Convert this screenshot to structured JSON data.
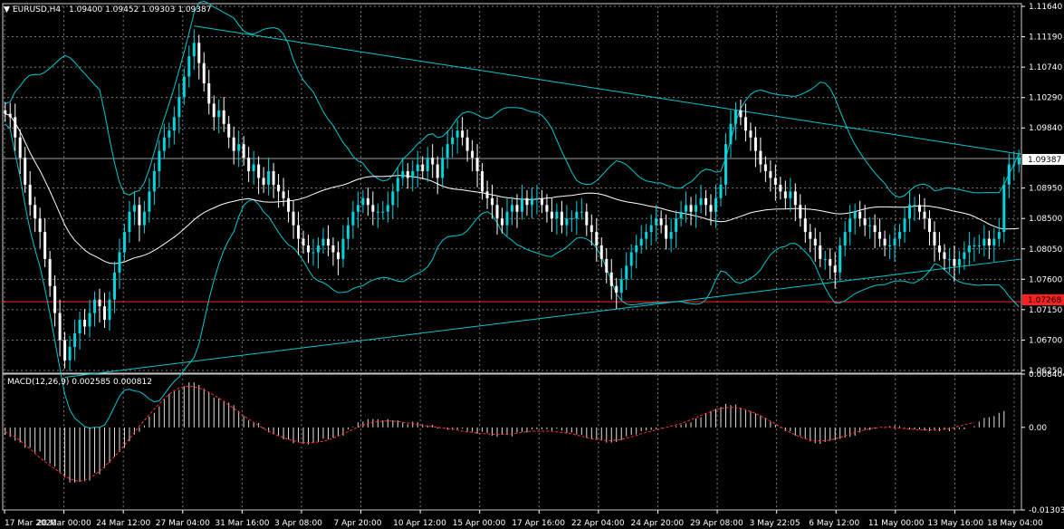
{
  "chart_data": [
    {
      "type": "candlestick",
      "header": {
        "symbol_tf": "EURUSD,H4",
        "values": "1.09400 1.09452 1.09303 1.09387"
      },
      "colors": {
        "background": "#000000",
        "bull": "#00d4dc",
        "bear": "#ffffff",
        "band": "#00c8d0",
        "ma": "#ffffff",
        "trend": "#00c8d0",
        "level": "#ff2020",
        "grid": "#7a7a7a",
        "text": "#ffffff"
      },
      "ylim": [
        1.0625,
        1.1164
      ],
      "yticks": [
        "1.11640",
        "1.11190",
        "1.10740",
        "1.10290",
        "1.09840",
        "1.09387",
        "1.08950",
        "1.08500",
        "1.08050",
        "1.07600",
        "1.07150",
        "1.06700",
        "1.06250"
      ],
      "current_price": {
        "label": "1.09387",
        "value": 1.09387
      },
      "level_line": {
        "label": "1.07268",
        "value": 1.07268
      },
      "xlabels": [
        "17 Mar 2020",
        "20 Mar 00:00",
        "24 Mar 12:00",
        "27 Mar 04:00",
        "31 Mar 16:00",
        "3 Apr 08:00",
        "7 Apr 20:00",
        "10 Apr 12:00",
        "15 Apr 00:00",
        "17 Apr 16:00",
        "22 Apr 04:00",
        "24 Apr 20:00",
        "29 Apr 08:00",
        "3 May 22:05",
        "6 May 12:00",
        "11 May 00:00",
        "13 May 16:00",
        "18 May 04:00"
      ],
      "close": [
        1.1005,
        1.1,
        1.097,
        1.094,
        1.09,
        1.087,
        1.085,
        1.083,
        1.079,
        1.075,
        1.071,
        1.067,
        1.064,
        1.066,
        1.068,
        1.07,
        1.069,
        1.071,
        1.073,
        1.072,
        1.07,
        1.073,
        1.077,
        1.08,
        1.083,
        1.086,
        1.087,
        1.084,
        1.086,
        1.089,
        1.092,
        1.095,
        1.097,
        1.098,
        1.1,
        1.103,
        1.106,
        1.109,
        1.111,
        1.108,
        1.105,
        1.102,
        1.1,
        1.101,
        1.099,
        1.097,
        1.095,
        1.096,
        1.094,
        1.092,
        1.093,
        1.091,
        1.09,
        1.092,
        1.09,
        1.089,
        1.088,
        1.086,
        1.084,
        1.082,
        1.081,
        1.08,
        1.08,
        1.081,
        1.082,
        1.081,
        1.08,
        1.079,
        1.082,
        1.084,
        1.086,
        1.087,
        1.088,
        1.087,
        1.086,
        1.086,
        1.086,
        1.087,
        1.089,
        1.091,
        1.092,
        1.091,
        1.092,
        1.093,
        1.092,
        1.094,
        1.093,
        1.091,
        1.094,
        1.096,
        1.097,
        1.098,
        1.097,
        1.095,
        1.094,
        1.092,
        1.089,
        1.088,
        1.087,
        1.085,
        1.084,
        1.086,
        1.087,
        1.086,
        1.088,
        1.087,
        1.088,
        1.088,
        1.087,
        1.086,
        1.085,
        1.086,
        1.084,
        1.085,
        1.085,
        1.086,
        1.086,
        1.084,
        1.083,
        1.081,
        1.079,
        1.077,
        1.075,
        1.074,
        1.076,
        1.078,
        1.08,
        1.081,
        1.082,
        1.083,
        1.084,
        1.085,
        1.084,
        1.082,
        1.083,
        1.085,
        1.086,
        1.087,
        1.086,
        1.087,
        1.088,
        1.087,
        1.086,
        1.088,
        1.09,
        1.096,
        1.099,
        1.101,
        1.1,
        1.098,
        1.097,
        1.095,
        1.093,
        1.092,
        1.091,
        1.09,
        1.089,
        1.088,
        1.089,
        1.087,
        1.085,
        1.083,
        1.082,
        1.081,
        1.079,
        1.079,
        1.078,
        1.077,
        1.081,
        1.083,
        1.085,
        1.086,
        1.085,
        1.084,
        1.084,
        1.083,
        1.082,
        1.081,
        1.081,
        1.082,
        1.083,
        1.085,
        1.087,
        1.087,
        1.086,
        1.085,
        1.083,
        1.081,
        1.08,
        1.079,
        1.079,
        1.078,
        1.079,
        1.08,
        1.081,
        1.081,
        1.081,
        1.082,
        1.081,
        1.082,
        1.083,
        1.09,
        1.093,
        1.093,
        1.094
      ]
    },
    {
      "type": "histogram",
      "header": "MACD(12,26,9) 0.002585 0.000812",
      "ylim": [
        -0.013033,
        0.008404
      ],
      "yticks": [
        "0.008404",
        "0.00",
        "-0.013033"
      ],
      "main_color": "#e0e0e0",
      "signal_color": "#ff3030",
      "values": [
        -0.0012,
        -0.0015,
        -0.0021,
        -0.0024,
        -0.0032,
        -0.0032,
        -0.004,
        -0.0038,
        -0.0052,
        -0.0057,
        -0.0062,
        -0.0072,
        -0.0079,
        -0.0087,
        -0.0087,
        -0.0086,
        -0.0085,
        -0.0084,
        -0.0072,
        -0.0074,
        -0.0064,
        -0.0056,
        -0.0046,
        -0.0039,
        -0.0032,
        -0.0022,
        -0.0011,
        -0.0007,
        0.0003,
        0.0017,
        0.0023,
        0.0033,
        0.0045,
        0.0053,
        0.0057,
        0.0059,
        0.0065,
        0.0071,
        0.0071,
        0.0067,
        0.0061,
        0.0056,
        0.0047,
        0.0046,
        0.0042,
        0.0039,
        0.0035,
        0.0026,
        0.0018,
        0.0011,
        0.0007,
        0.0007,
        -0.0002,
        -0.0008,
        -0.0011,
        -0.0014,
        -0.0019,
        -0.0019,
        -0.0025,
        -0.0024,
        -0.0026,
        -0.0027,
        -0.0025,
        -0.0023,
        -0.0018,
        -0.0019,
        -0.0016,
        -0.0013,
        -0.0013,
        -0.0003,
        0.0001,
        0.0008,
        0.0009,
        0.0013,
        0.0013,
        0.0013,
        0.0011,
        0.0013,
        0.0011,
        0.0011,
        0.0008,
        0.0005,
        0.0009,
        0.0008,
        0.0005,
        0.0003,
        0.0004,
        -0.0002,
        0.0,
        -0.0004,
        -0.0004,
        -0.0003,
        -0.0002,
        -0.0007,
        -0.0007,
        -0.001,
        -0.0007,
        -0.0009,
        -0.0013,
        -0.0015,
        -0.0011,
        -0.0012,
        -0.0014,
        -0.0008,
        -0.0007,
        -0.0008,
        -0.0003,
        -0.0003,
        -0.0003,
        -0.0003,
        -0.0005,
        -0.0002,
        -0.0005,
        -0.0009,
        -0.0008,
        -0.0011,
        -0.0012,
        -0.0017,
        -0.0019,
        -0.0019,
        -0.002,
        -0.0024,
        -0.0024,
        -0.0023,
        -0.002,
        -0.0014,
        -0.0012,
        -0.0011,
        -0.0006,
        -0.0005,
        -0.0004,
        -0.0003,
        -0.0001,
        0.0,
        0.0,
        0.0002,
        0.0004,
        0.0006,
        0.0008,
        0.0014,
        0.0016,
        0.0022,
        0.0026,
        0.0029,
        0.0032,
        0.0037,
        0.0035,
        0.0036,
        0.0031,
        0.0027,
        0.0026,
        0.0022,
        0.0019,
        0.0015,
        0.0009,
        0.0004,
        -0.0001,
        -0.0006,
        -0.0006,
        -0.0013,
        -0.0014,
        -0.0018,
        -0.0022,
        -0.0025,
        -0.0026,
        -0.0023,
        -0.0021,
        -0.002,
        -0.0018,
        -0.0016,
        -0.0015,
        -0.0013,
        -0.0008,
        -0.0004,
        -0.0004,
        -0.0002,
        0.0,
        -0.0001,
        0.0002,
        0.0003,
        0.0002,
        -0.0001,
        -0.0003,
        -0.0003,
        -0.0003,
        -0.0005,
        -0.0006,
        -0.0005,
        -0.0006,
        -0.0004,
        -0.0006,
        -0.0003,
        -0.0003,
        -0.0003,
        0.0,
        0.0002,
        0.0009,
        0.0015,
        0.0016,
        0.0018,
        0.0023,
        0.0026
      ],
      "signal": [
        -0.0007,
        -0.0011,
        -0.0015,
        -0.0021,
        -0.0027,
        -0.0034,
        -0.0041,
        -0.0048,
        -0.0054,
        -0.006,
        -0.0065,
        -0.0071,
        -0.0077,
        -0.0081,
        -0.0084,
        -0.0085,
        -0.0083,
        -0.008,
        -0.0075,
        -0.0069,
        -0.0062,
        -0.0054,
        -0.0046,
        -0.0037,
        -0.0028,
        -0.0018,
        -0.0008,
        0.0002,
        0.0011,
        0.002,
        0.0029,
        0.0037,
        0.0045,
        0.0052,
        0.0058,
        0.0062,
        0.0064,
        0.0065,
        0.0064,
        0.0062,
        0.0059,
        0.0055,
        0.0051,
        0.0046,
        0.0041,
        0.0035,
        0.003,
        0.0024,
        0.0018,
        0.0013,
        0.0008,
        0.0003,
        -0.0002,
        -0.0006,
        -0.001,
        -0.0013,
        -0.0016,
        -0.0019,
        -0.0021,
        -0.0023,
        -0.0024,
        -0.0024,
        -0.0024,
        -0.0023,
        -0.0022,
        -0.002,
        -0.0017,
        -0.0014,
        -0.001,
        -0.0007,
        -0.0003,
        0.0,
        0.0003,
        0.0006,
        0.0008,
        0.0009,
        0.001,
        0.001,
        0.001,
        0.0009,
        0.0008,
        0.0007,
        0.0006,
        0.0004,
        0.0003,
        0.0002,
        0.0001,
        -0.0,
        -0.0001,
        -0.0002,
        -0.0003,
        -0.0004,
        -0.0006,
        -0.0007,
        -0.0008,
        -0.0009,
        -0.001,
        -0.001,
        -0.0011,
        -0.0011,
        -0.0011,
        -0.0011,
        -0.001,
        -0.0009,
        -0.0008,
        -0.0007,
        -0.0006,
        -0.0006,
        -0.0006,
        -0.0006,
        -0.0006,
        -0.0007,
        -0.0008,
        -0.0009,
        -0.001,
        -0.0012,
        -0.0014,
        -0.0016,
        -0.0018,
        -0.0019,
        -0.002,
        -0.0021,
        -0.0021,
        -0.002,
        -0.0019,
        -0.0017,
        -0.0015,
        -0.0013,
        -0.001,
        -0.0008,
        -0.0006,
        -0.0004,
        -0.0002,
        0.0,
        0.0002,
        0.0004,
        0.0006,
        0.0009,
        0.0012,
        0.0015,
        0.0019,
        0.0022,
        0.0025,
        0.0028,
        0.003,
        0.0031,
        0.0032,
        0.0031,
        0.003,
        0.0028,
        0.0025,
        0.0022,
        0.0018,
        0.0014,
        0.001,
        0.0005,
        0.0001,
        -0.0004,
        -0.0008,
        -0.0012,
        -0.0015,
        -0.0018,
        -0.002,
        -0.0021,
        -0.0021,
        -0.0021,
        -0.002,
        -0.0018,
        -0.0016,
        -0.0013,
        -0.0011,
        -0.0008,
        -0.0006,
        -0.0004,
        -0.0002,
        -0.0001,
        -0.0,
        0.0,
        0.0,
        -0.0001,
        -0.0001,
        -0.0002,
        -0.0003,
        -0.0003,
        -0.0004,
        -0.0004,
        -0.0004,
        -0.0004,
        -0.0004,
        -0.0003,
        -0.0002,
        -0.0,
        0.0002,
        0.0004,
        0.0006,
        0.0008
      ]
    }
  ]
}
